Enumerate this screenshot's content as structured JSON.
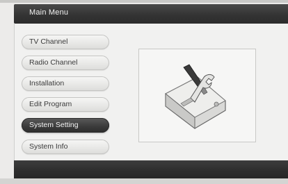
{
  "window": {
    "title": "Main Menu"
  },
  "menu": {
    "items": [
      {
        "label": "TV Channel",
        "selected": false
      },
      {
        "label": "Radio Channel",
        "selected": false
      },
      {
        "label": "Installation",
        "selected": false
      },
      {
        "label": "Edit Program",
        "selected": false
      },
      {
        "label": "System Setting",
        "selected": true
      },
      {
        "label": "System Info",
        "selected": false
      }
    ]
  },
  "preview": {
    "icon": "system-setting-tools-icon"
  },
  "colors": {
    "bar_dark": "#333333",
    "selected_item": "#3a3a3a",
    "panel": "#f1f1f0"
  }
}
